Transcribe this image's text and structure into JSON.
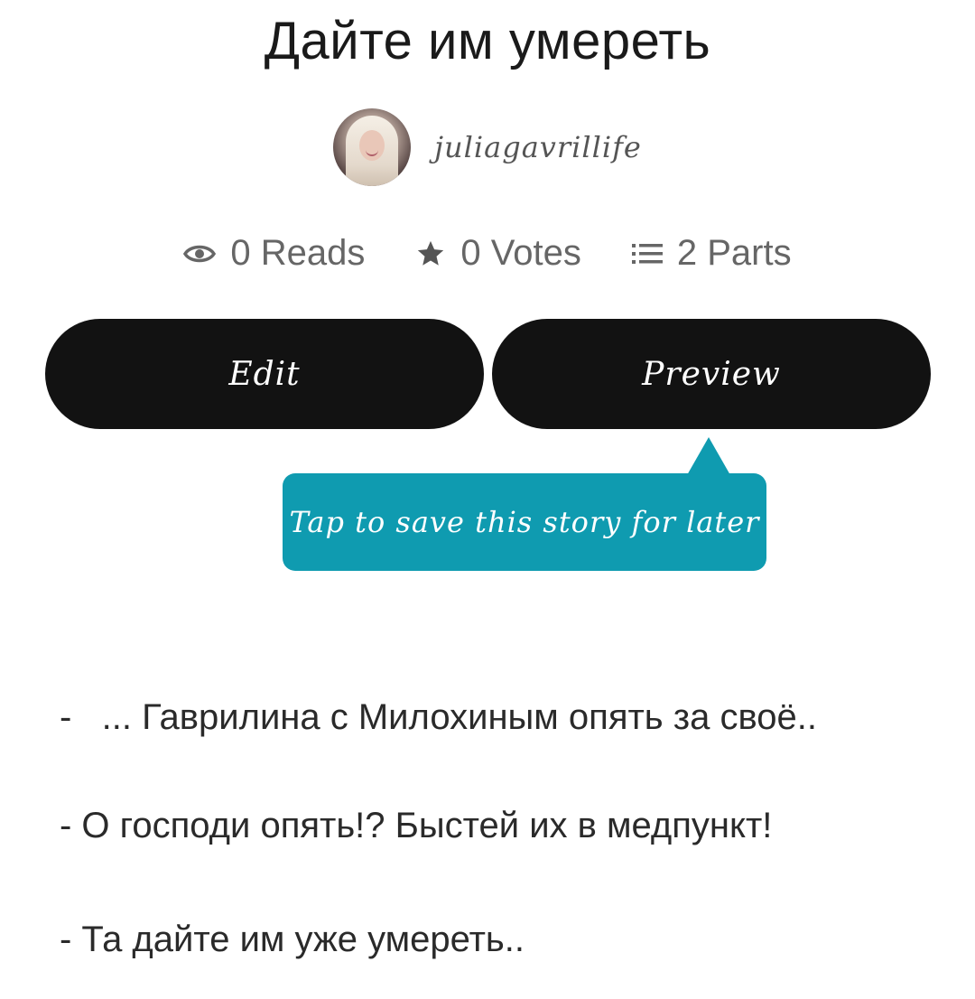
{
  "story": {
    "title": "Дайте им умереть",
    "author": "juliagavrillife"
  },
  "stats": {
    "reads": "0 Reads",
    "votes": "0 Votes",
    "parts": "2 Parts"
  },
  "icons": {
    "reads": "eye-icon",
    "votes": "star-icon",
    "parts": "list-icon"
  },
  "buttons": {
    "edit": "Edit",
    "preview": "Preview"
  },
  "tooltip": {
    "text": "Tap to save this story for later"
  },
  "content": {
    "lines": [
      "-   ... Гаврилина с Милохиным опять за своё..",
      "- О господи опять!? Быстей их в медпункт!",
      "- Та дайте им уже умереть.."
    ]
  },
  "colors": {
    "button": "#121212",
    "tooltip": "#0f9bb0",
    "stats": "#666666"
  }
}
